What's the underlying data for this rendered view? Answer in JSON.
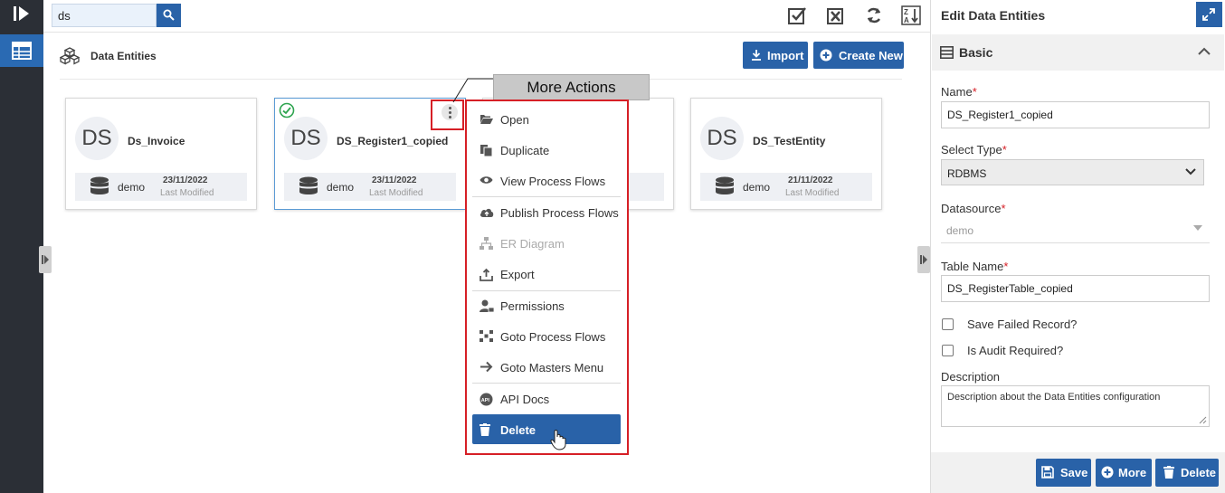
{
  "search": {
    "value": "ds",
    "button_icon": "search-icon"
  },
  "toolbar": {
    "icons": [
      "check-all-icon",
      "clear-selection-icon",
      "refresh-icon",
      "sort-az-icon"
    ]
  },
  "breadcrumb": {
    "title": "Data Entities",
    "icon": "cubes-icon"
  },
  "actions": {
    "import_label": "Import",
    "create_label": "Create New"
  },
  "cards": [
    {
      "initials": "DS",
      "name": "Ds_Invoice",
      "datasource": "demo",
      "modified_date": "23/11/2022",
      "modified_label": "Last Modified"
    },
    {
      "initials": "DS",
      "name": "DS_Register1_copied",
      "datasource": "demo",
      "modified_date": "23/11/2022",
      "modified_label": "Last Modified",
      "selected": true
    },
    {
      "initials": "DS",
      "name": "DS_TestEntity",
      "datasource": "demo",
      "modified_date": "21/11/2022",
      "modified_label": "Last Modified"
    }
  ],
  "callout": {
    "text": "More Actions"
  },
  "menu": {
    "items": [
      {
        "label": "Open",
        "icon": "folder-open-icon"
      },
      {
        "label": "Duplicate",
        "icon": "duplicate-icon"
      },
      {
        "label": "View Process Flows",
        "icon": "eye-icon"
      },
      {
        "label": "Publish Process Flows",
        "icon": "cloud-upload-icon"
      },
      {
        "label": "ER Diagram",
        "icon": "sitemap-icon",
        "disabled": true
      },
      {
        "label": "Export",
        "icon": "export-icon"
      },
      {
        "label": "Permissions",
        "icon": "user-lock-icon"
      },
      {
        "label": "Goto Process Flows",
        "icon": "process-flow-icon"
      },
      {
        "label": "Goto Masters Menu",
        "icon": "arrow-right-icon"
      },
      {
        "label": "API Docs",
        "icon": "api-icon"
      },
      {
        "label": "Delete",
        "icon": "trash-icon"
      }
    ]
  },
  "panel": {
    "title": "Edit Data Entities",
    "section": "Basic",
    "fields": {
      "name": {
        "label": "Name",
        "value": "DS_Register1_copied"
      },
      "type": {
        "label": "Select Type",
        "value": "RDBMS"
      },
      "datasource": {
        "label": "Datasource",
        "value": "demo"
      },
      "table": {
        "label": "Table Name",
        "value": "DS_RegisterTable_copied"
      },
      "save_failed": {
        "label": "Save Failed Record?"
      },
      "audit": {
        "label": "Is Audit Required?"
      },
      "description": {
        "label": "Description",
        "placeholder": "Description about the Data Entities configuration"
      }
    },
    "footer": {
      "save": "Save",
      "more": "More",
      "delete": "Delete"
    }
  },
  "colors": {
    "primary": "#2962a8",
    "rail": "#2b2f36",
    "highlight": "#d61f26"
  }
}
